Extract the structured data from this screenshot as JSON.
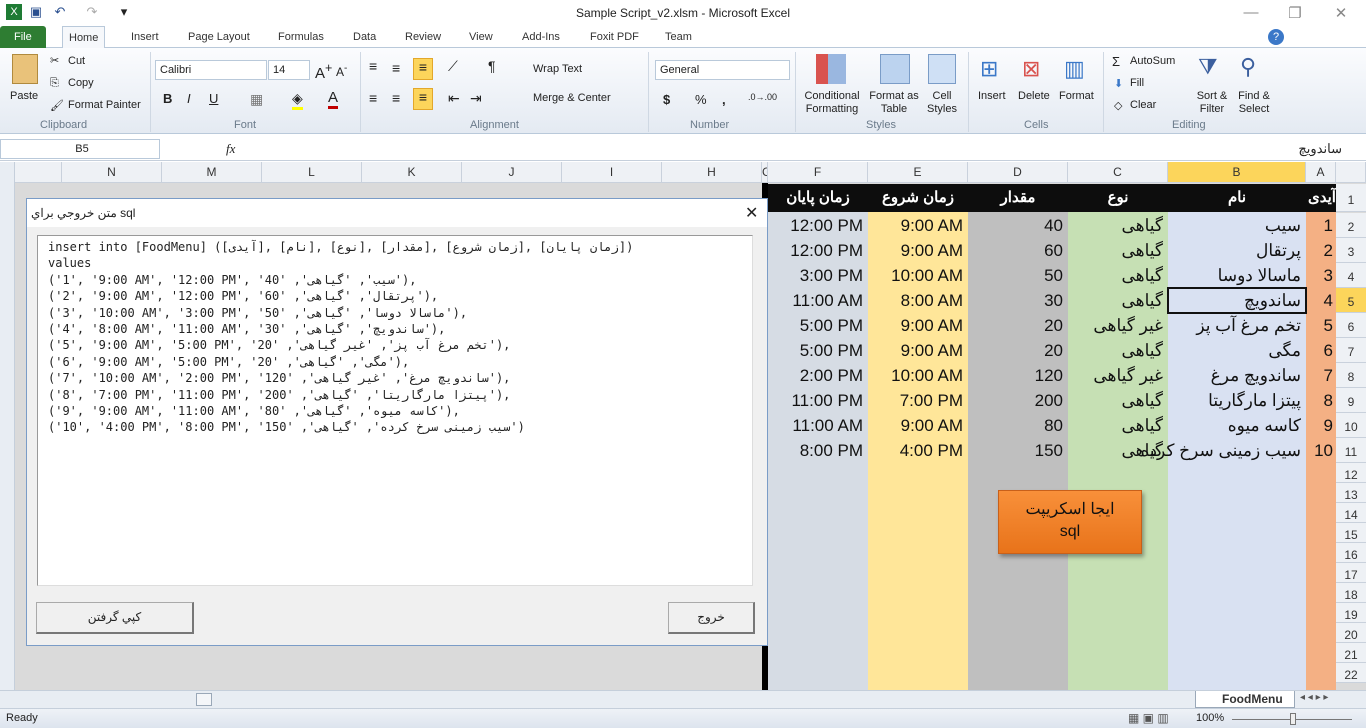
{
  "window": {
    "title": "Sample Script_v2.xlsm - Microsoft Excel",
    "minimize": "—",
    "restore": "❐",
    "close": "✕"
  },
  "tabs": [
    "File",
    "Home",
    "Insert",
    "Page Layout",
    "Formulas",
    "Data",
    "Review",
    "View",
    "Add-Ins",
    "Foxit PDF",
    "Team"
  ],
  "ribbon": {
    "clipboard": {
      "paste": "Paste",
      "cut": "Cut",
      "copy": "Copy",
      "format_painter": "Format Painter",
      "label": "Clipboard"
    },
    "font": {
      "name": "Calibri",
      "size": "14",
      "label": "Font",
      "bold": "B",
      "italic": "I",
      "underline": "U"
    },
    "alignment": {
      "wrap": "Wrap Text",
      "merge": "Merge & Center",
      "label": "Alignment"
    },
    "number": {
      "format": "General",
      "currency": "$",
      "percent": "%",
      "comma": ",",
      "label": "Number"
    },
    "styles": {
      "conditional": "Conditional Formatting",
      "format_table": "Format as Table",
      "cell_styles": "Cell Styles",
      "label": "Styles"
    },
    "cells": {
      "insert": "Insert",
      "delete": "Delete",
      "format": "Format",
      "label": "Cells"
    },
    "editing": {
      "autosum": "AutoSum",
      "fill": "Fill",
      "clear": "Clear",
      "sort": "Sort & Filter",
      "find": "Find & Select",
      "label": "Editing"
    }
  },
  "formula_bar": {
    "name_box": "B5",
    "fx": "fx",
    "value": "ساندویچ"
  },
  "columns_left": [
    "N",
    "M",
    "L",
    "K",
    "J",
    "I",
    "H",
    "G"
  ],
  "columns_right": [
    "F",
    "E",
    "D",
    "C",
    "B",
    "A"
  ],
  "sheet": {
    "headers": [
      "زمان پایان",
      "زمان شروع",
      "مقدار",
      "نوع",
      "نام",
      "آیدی"
    ],
    "rows": [
      [
        "12:00 PM",
        "9:00 AM",
        "40",
        "گیاهی",
        "سیب",
        "1"
      ],
      [
        "12:00 PM",
        "9:00 AM",
        "60",
        "گیاهی",
        "پرتقال",
        "2"
      ],
      [
        "3:00 PM",
        "10:00 AM",
        "50",
        "گیاهی",
        "ماسالا دوسا",
        "3"
      ],
      [
        "11:00 AM",
        "8:00 AM",
        "30",
        "گیاهی",
        "ساندویچ",
        "4"
      ],
      [
        "5:00 PM",
        "9:00 AM",
        "20",
        "غیر گیاهی",
        "تخم مرغ آب پز",
        "5"
      ],
      [
        "5:00 PM",
        "9:00 AM",
        "20",
        "گیاهی",
        "مگی",
        "6"
      ],
      [
        "2:00 PM",
        "10:00 AM",
        "120",
        "غیر گیاهی",
        "ساندویچ مرغ",
        "7"
      ],
      [
        "11:00 PM",
        "7:00 PM",
        "200",
        "گیاهی",
        "پیتزا مارگاریتا",
        "8"
      ],
      [
        "11:00 AM",
        "9:00 AM",
        "80",
        "گیاهی",
        "کاسه میوه",
        "9"
      ],
      [
        "8:00 PM",
        "4:00 PM",
        "150",
        "گیاهی",
        "سیب زمینی سرخ کرده",
        "10"
      ]
    ],
    "row_numbers": [
      "1",
      "2",
      "3",
      "4",
      "5",
      "6",
      "7",
      "8",
      "9",
      "10",
      "11",
      "12",
      "13",
      "14",
      "15",
      "16",
      "17",
      "18",
      "19",
      "20",
      "21",
      "22"
    ],
    "selected_cell": "B5",
    "column_colors": {
      "F": "#d6dce4",
      "E": "#ffe699",
      "D": "#bfbfbf",
      "C": "#c6e0b4",
      "B": "#d9e1f2",
      "A": "#f4b084"
    },
    "script_button": "ایجا اسکریپت sql",
    "sheet_tab": "FoodMenu"
  },
  "dialog": {
    "title": "متن خروجي براي sql",
    "sql_lines": [
      "insert into [FoodMenu] ([آیدی], [نام], [نوع], [مقدار], [زمان شروع], [زمان پایان])",
      "values",
      "('1', '9:00 AM', '12:00 PM', 'سیب', 'گیاهی', '40'),",
      "('2', '9:00 AM', '12:00 PM', 'پرتقال', 'گیاهی', '60'),",
      "('3', '10:00 AM', '3:00 PM', 'ماسالا دوسا', 'گیاهی', '50'),",
      "('4', '8:00 AM', '11:00 AM', 'ساندویچ', 'گیاهی', '30'),",
      "('5', '9:00 AM', '5:00 PM', 'تخم مرغ آب پز', 'غیر گیاهی', '20'),",
      "('6', '9:00 AM', '5:00 PM', 'مگی', 'گیاهی', '20'),",
      "('7', '10:00 AM', '2:00 PM', 'ساندویچ مرغ', 'غیر گیاهی', '120'),",
      "('8', '7:00 PM', '11:00 PM', 'پیتزا مارگاریتا', 'گیاهی', '200'),",
      "('9', '9:00 AM', '11:00 AM', 'کاسه میوه', 'گیاهی', '80'),",
      "('10', '4:00 PM', '8:00 PM', 'سیب زمینی سرخ کرده', 'گیاهی', '150')"
    ],
    "copy_button": "كپي گرفتن",
    "exit_button": "خروج",
    "close": "✕"
  },
  "status": {
    "ready": "Ready",
    "zoom": "100%"
  }
}
